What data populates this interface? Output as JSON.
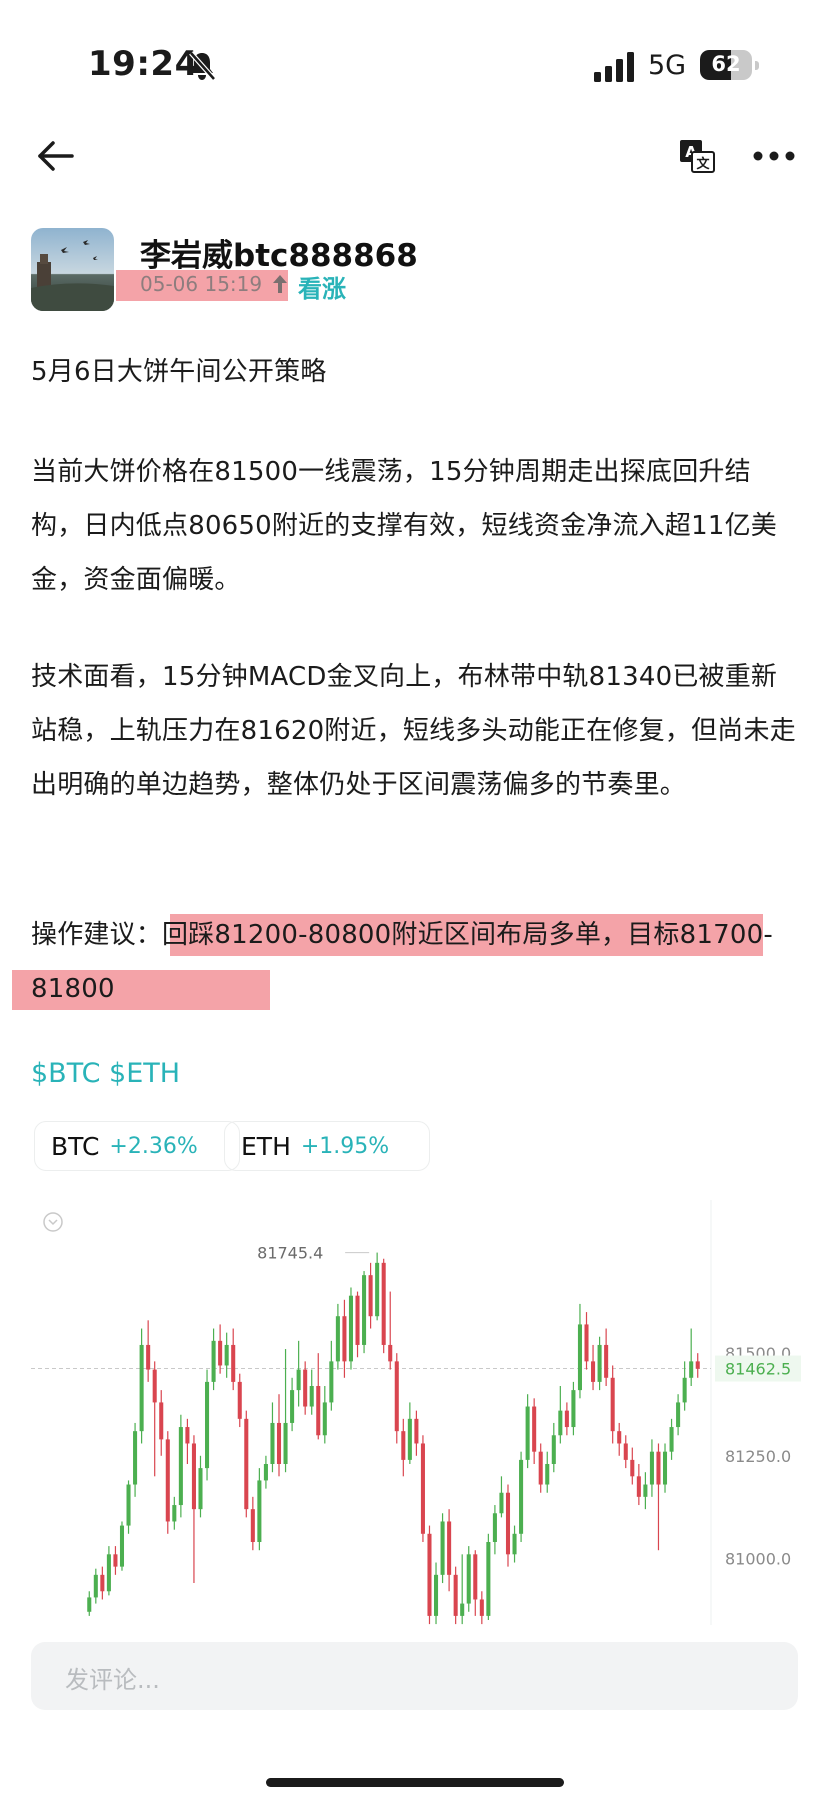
{
  "status_bar": {
    "time": "19:24",
    "network": "5G",
    "battery": "62",
    "icons": [
      "bell-off-icon",
      "signal-icon",
      "battery-icon"
    ]
  },
  "nav": {
    "icons": [
      "back-arrow-icon",
      "translate-icon",
      "more-icon"
    ]
  },
  "author": {
    "name": "李岩威btc888868",
    "date": "05-06 15:19",
    "sentiment": "看涨",
    "sentiment_icon": "up-arrow-icon"
  },
  "post": {
    "title": "5月6日大饼午间公开策略",
    "paragraph_1": "当前大饼价格在81500一线震荡，15分钟周期走出探底回升结构，日内低点80650附近的支撑有效，短线资金净流入超11亿美金，资金面偏暖。",
    "paragraph_2": "技术面看，15分钟MACD金叉向上，布林带中轨81340已被重新站稳，上轨压力在81620附近，短线多头动能正在修复，但尚未走出明确的单边趋势，整体仍处于区间震荡偏多的节奏里。",
    "advice_label": "操作建议：",
    "advice_text": "回踩81200-80800附近区间布局多单，目标81700-81800",
    "highlight_color": "#f4a3a8"
  },
  "tags": "$BTC $ETH",
  "tickers": [
    {
      "symbol": "BTC",
      "change": "+2.36%"
    },
    {
      "symbol": "ETH",
      "change": "+1.95%"
    }
  ],
  "chart_data": {
    "type": "candlestick",
    "peak_label": "81745.4",
    "current_price": "81462.5",
    "y_ticks": [
      "81500.0",
      "81250.0",
      "81000.0"
    ],
    "ylim": [
      80850,
      81800
    ],
    "up_color": "#4caf50",
    "down_color": "#d9454f",
    "candles": [
      [
        80870,
        80905,
        80860,
        80920
      ],
      [
        80905,
        80960,
        80890,
        80975
      ],
      [
        80960,
        80920,
        80900,
        80980
      ],
      [
        80920,
        81010,
        80910,
        81030
      ],
      [
        81010,
        80980,
        80960,
        81030
      ],
      [
        80980,
        81080,
        80970,
        81090
      ],
      [
        81080,
        81180,
        81060,
        81190
      ],
      [
        81180,
        81310,
        81150,
        81330
      ],
      [
        81310,
        81520,
        81280,
        81560
      ],
      [
        81520,
        81460,
        81430,
        81580
      ],
      [
        81460,
        81380,
        81200,
        81480
      ],
      [
        81380,
        81290,
        81250,
        81410
      ],
      [
        81290,
        81090,
        81060,
        81310
      ],
      [
        81090,
        81130,
        81070,
        81150
      ],
      [
        81130,
        81320,
        81100,
        81350
      ],
      [
        81320,
        81280,
        81230,
        81340
      ],
      [
        81280,
        81120,
        80940,
        81300
      ],
      [
        81120,
        81220,
        81100,
        81250
      ],
      [
        81220,
        81430,
        81190,
        81460
      ],
      [
        81430,
        81530,
        81410,
        81560
      ],
      [
        81530,
        81470,
        81450,
        81570
      ],
      [
        81470,
        81520,
        81440,
        81550
      ],
      [
        81520,
        81430,
        81410,
        81560
      ],
      [
        81430,
        81340,
        81320,
        81450
      ],
      [
        81340,
        81120,
        81100,
        81360
      ],
      [
        81120,
        81040,
        81020,
        81150
      ],
      [
        81040,
        81190,
        81020,
        81220
      ],
      [
        81190,
        81230,
        81170,
        81250
      ],
      [
        81230,
        81330,
        81210,
        81380
      ],
      [
        81330,
        81230,
        81200,
        81400
      ],
      [
        81230,
        81330,
        81210,
        81510
      ],
      [
        81330,
        81410,
        81310,
        81440
      ],
      [
        81410,
        81460,
        81370,
        81530
      ],
      [
        81460,
        81370,
        81350,
        81480
      ],
      [
        81370,
        81420,
        81350,
        81460
      ],
      [
        81420,
        81300,
        81290,
        81500
      ],
      [
        81300,
        81380,
        81280,
        81420
      ],
      [
        81380,
        81480,
        81360,
        81530
      ],
      [
        81480,
        81590,
        81460,
        81620
      ],
      [
        81590,
        81480,
        81440,
        81630
      ],
      [
        81480,
        81640,
        81460,
        81660
      ],
      [
        81640,
        81520,
        81490,
        81650
      ],
      [
        81520,
        81690,
        81500,
        81700
      ],
      [
        81690,
        81590,
        81560,
        81720
      ],
      [
        81590,
        81720,
        81580,
        81745
      ],
      [
        81720,
        81520,
        81500,
        81730
      ],
      [
        81520,
        81480,
        81460,
        81650
      ],
      [
        81480,
        81310,
        81280,
        81500
      ],
      [
        81310,
        81240,
        81200,
        81340
      ],
      [
        81240,
        81340,
        81230,
        81380
      ],
      [
        81340,
        81280,
        81250,
        81360
      ],
      [
        81280,
        81060,
        81040,
        81300
      ],
      [
        81060,
        80860,
        80840,
        81080
      ],
      [
        80860,
        80960,
        80840,
        80990
      ],
      [
        80960,
        81090,
        80940,
        81110
      ],
      [
        81090,
        80960,
        80920,
        81120
      ],
      [
        80960,
        80860,
        80840,
        80980
      ],
      [
        80860,
        80890,
        80840,
        81010
      ],
      [
        80890,
        81010,
        80870,
        81030
      ],
      [
        81010,
        80900,
        80860,
        81020
      ],
      [
        80900,
        80860,
        80840,
        80920
      ],
      [
        80860,
        81040,
        80850,
        81060
      ],
      [
        81040,
        81110,
        81010,
        81130
      ],
      [
        81110,
        81160,
        81100,
        81200
      ],
      [
        81160,
        81010,
        80980,
        81180
      ],
      [
        81010,
        81060,
        80990,
        81080
      ],
      [
        81060,
        81240,
        81040,
        81260
      ],
      [
        81240,
        81370,
        81220,
        81400
      ],
      [
        81370,
        81260,
        81230,
        81390
      ],
      [
        81260,
        81180,
        81160,
        81280
      ],
      [
        81180,
        81230,
        81160,
        81260
      ],
      [
        81230,
        81300,
        81210,
        81330
      ],
      [
        81300,
        81360,
        81280,
        81420
      ],
      [
        81360,
        81320,
        81300,
        81380
      ],
      [
        81320,
        81410,
        81300,
        81430
      ],
      [
        81410,
        81570,
        81390,
        81620
      ],
      [
        81570,
        81480,
        81460,
        81600
      ],
      [
        81480,
        81430,
        81410,
        81520
      ],
      [
        81430,
        81520,
        81410,
        81540
      ],
      [
        81520,
        81440,
        81420,
        81560
      ],
      [
        81440,
        81310,
        81280,
        81470
      ],
      [
        81310,
        81280,
        81250,
        81330
      ],
      [
        81280,
        81240,
        81220,
        81300
      ],
      [
        81240,
        81200,
        81180,
        81270
      ],
      [
        81200,
        81150,
        81130,
        81230
      ],
      [
        81150,
        81180,
        81120,
        81210
      ],
      [
        81180,
        81260,
        81150,
        81290
      ],
      [
        81260,
        81180,
        81020,
        81280
      ],
      [
        81180,
        81260,
        81160,
        81280
      ],
      [
        81260,
        81320,
        81240,
        81340
      ],
      [
        81320,
        81380,
        81300,
        81400
      ],
      [
        81380,
        81440,
        81360,
        81480
      ],
      [
        81440,
        81480,
        81420,
        81560
      ],
      [
        81480,
        81462,
        81440,
        81500
      ]
    ]
  },
  "comment": {
    "placeholder": "发评论..."
  }
}
